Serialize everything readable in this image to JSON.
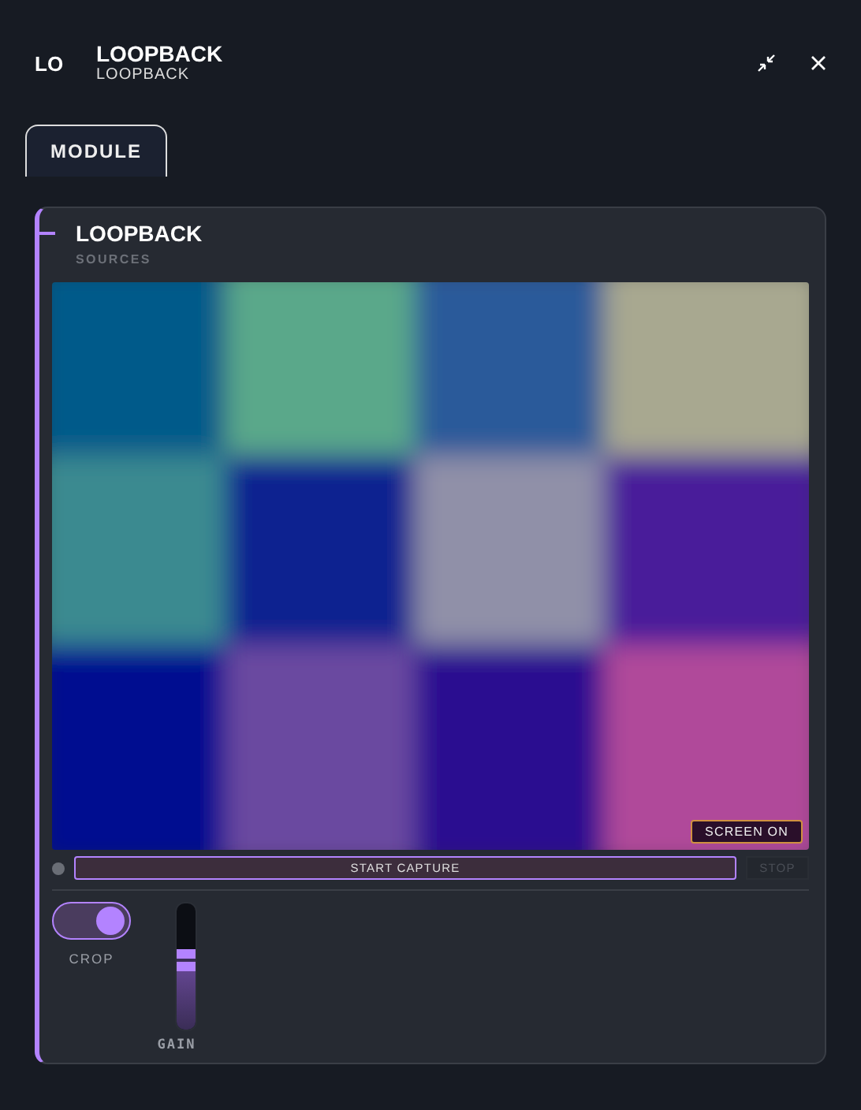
{
  "header": {
    "badge": "LO",
    "title": "LOOPBACK",
    "subtitle": "LOOPBACK"
  },
  "tabs": [
    {
      "label": "MODULE",
      "selected": true
    }
  ],
  "panel": {
    "title": "LOOPBACK",
    "subtitle": "SOURCES",
    "preview": {
      "kind": "picture",
      "overlay": "SCREEN ON"
    },
    "capture": {
      "recording": false,
      "start_label": "START CAPTURE",
      "stop_label": "STOP",
      "stop_disabled": true
    },
    "toggle": {
      "label": "CROP",
      "on": true
    },
    "slider": {
      "label": "GAIN",
      "level": 0.55
    }
  }
}
